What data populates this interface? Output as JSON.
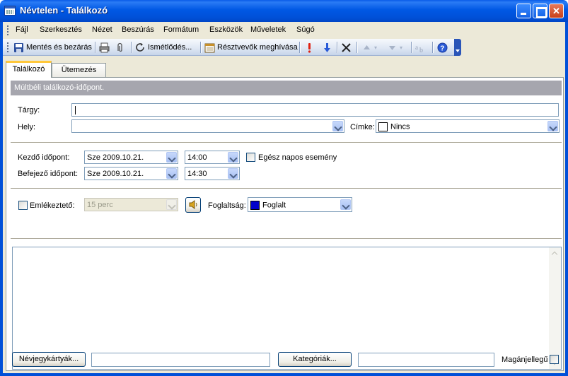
{
  "window": {
    "title": "Névtelen - Találkozó"
  },
  "menu": [
    {
      "label": "Fájl"
    },
    {
      "label": "Szerkesztés"
    },
    {
      "label": "Nézet"
    },
    {
      "label": "Beszúrás"
    },
    {
      "label": "Formátum"
    },
    {
      "label": "Eszközök"
    },
    {
      "label": "Műveletek"
    },
    {
      "label": "Súgó"
    }
  ],
  "toolbar": {
    "save_close": "Mentés és bezárás",
    "recurrence": "Ismétlődés...",
    "invite": "Résztvevők meghívása"
  },
  "tabs": {
    "appointment": "Találkozó",
    "schedule": "Ütemezés"
  },
  "info_bar": "Múltbéli találkozó-időpont.",
  "form": {
    "subject_label": "Tárgy:",
    "subject_value": "",
    "location_label": "Hely:",
    "location_value": "",
    "label_label": "Címke:",
    "label_value": "Nincs",
    "start_label": "Kezdő időpont:",
    "start_date": "Sze 2009.10.21.",
    "start_time": "14:00",
    "end_label": "Befejező időpont:",
    "end_date": "Sze 2009.10.21.",
    "end_time": "14:30",
    "all_day_label": "Egész napos esemény",
    "reminder_label": "Emlékeztető:",
    "reminder_value": "15 perc",
    "busy_label": "Foglaltság:",
    "busy_value": "Foglalt",
    "busy_color": "#0000cc"
  },
  "bottom": {
    "contacts_button": "Névjegykártyák...",
    "categories_button": "Kategóriák...",
    "private_label": "Magánjellegű"
  },
  "colors": {
    "titlebar": "#0054e3",
    "infobar": "#a6a6ae",
    "tab_highlight": "#ffc83c"
  }
}
